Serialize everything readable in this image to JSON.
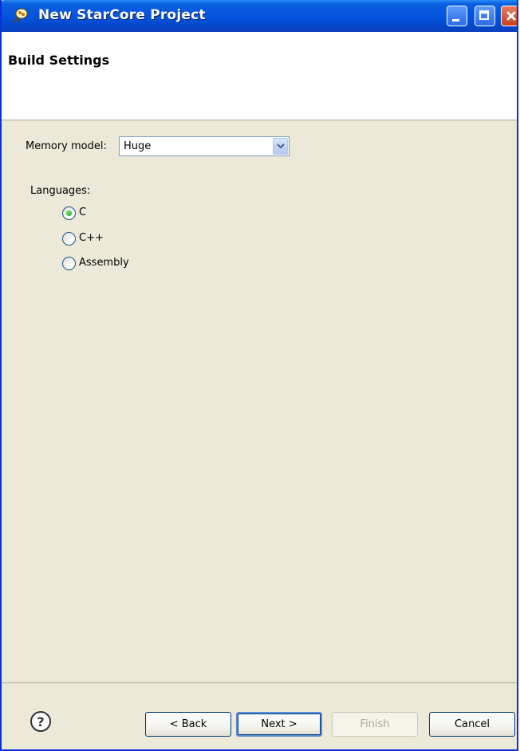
{
  "window": {
    "title": "New StarCore Project"
  },
  "header": {
    "title": "Build Settings"
  },
  "memory_model": {
    "label": "Memory model:",
    "selected": "Huge"
  },
  "languages": {
    "label": "Languages:",
    "options": [
      {
        "label": "C",
        "checked": true
      },
      {
        "label": "C++",
        "checked": false
      },
      {
        "label": "Assembly",
        "checked": false
      }
    ]
  },
  "buttons": {
    "back": "< Back",
    "next": "Next >",
    "finish": "Finish",
    "cancel": "Cancel"
  },
  "icons": {
    "app": "starcore-project-icon",
    "help": "help-icon"
  },
  "colors": {
    "titlebar": "#0554de",
    "dialog_bg": "#ece9d8",
    "radio_dot": "#21a121"
  }
}
